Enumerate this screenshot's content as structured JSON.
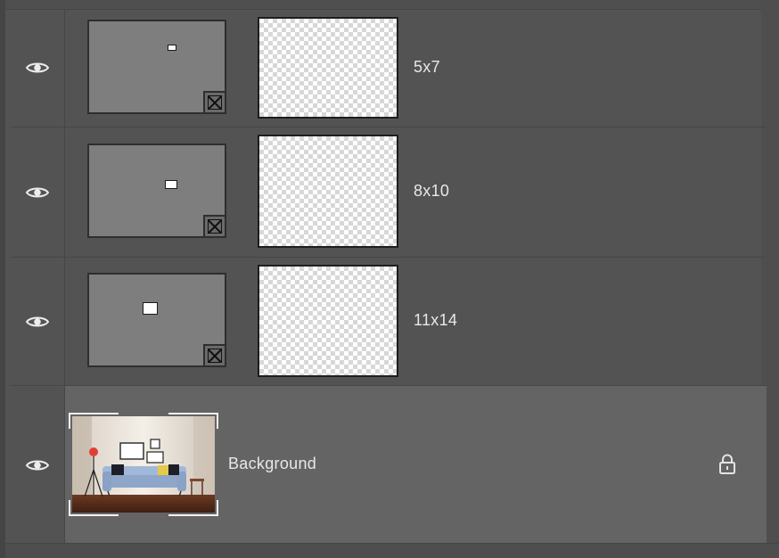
{
  "layers": [
    {
      "name": "5x7",
      "visibility_icon": "eye-icon",
      "mask_icon": "vector-mask-link-icon"
    },
    {
      "name": "8x10",
      "visibility_icon": "eye-icon",
      "mask_icon": "vector-mask-link-icon"
    },
    {
      "name": "11x14",
      "visibility_icon": "eye-icon",
      "mask_icon": "vector-mask-link-icon"
    },
    {
      "name": "Background",
      "visibility_icon": "eye-icon",
      "lock_icon": "lock-icon",
      "selected": true
    }
  ],
  "colors": {
    "panel_bg": "#535353",
    "selected_row_bg": "#646464",
    "text": "#e8e8e8"
  }
}
